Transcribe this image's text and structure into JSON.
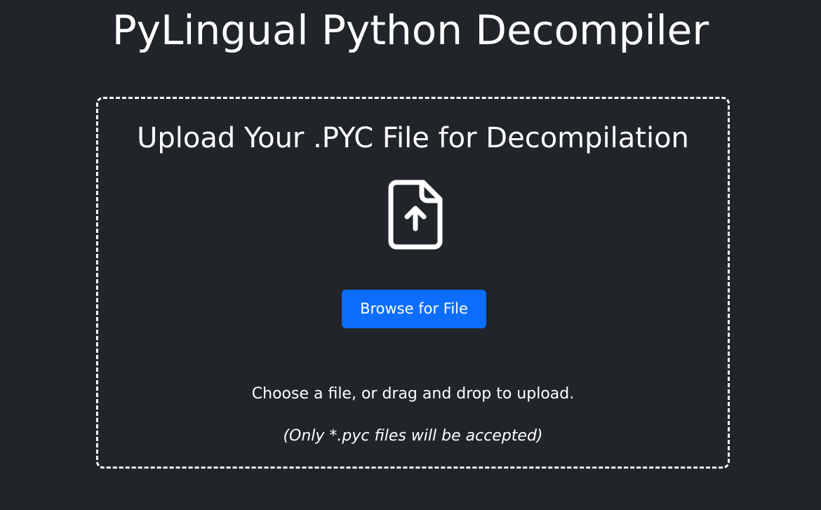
{
  "header": {
    "title": "PyLingual Python Decompiler"
  },
  "upload": {
    "heading": "Upload Your .PYC File for Decompilation",
    "icon": "file-upload-icon",
    "browse_label": "Browse for File",
    "instruction": "Choose a file, or drag and drop to upload.",
    "accepted_note": "(Only *.pyc files will be accepted)"
  },
  "colors": {
    "background": "#212529",
    "text": "#ffffff",
    "accent": "#0d6efd"
  }
}
